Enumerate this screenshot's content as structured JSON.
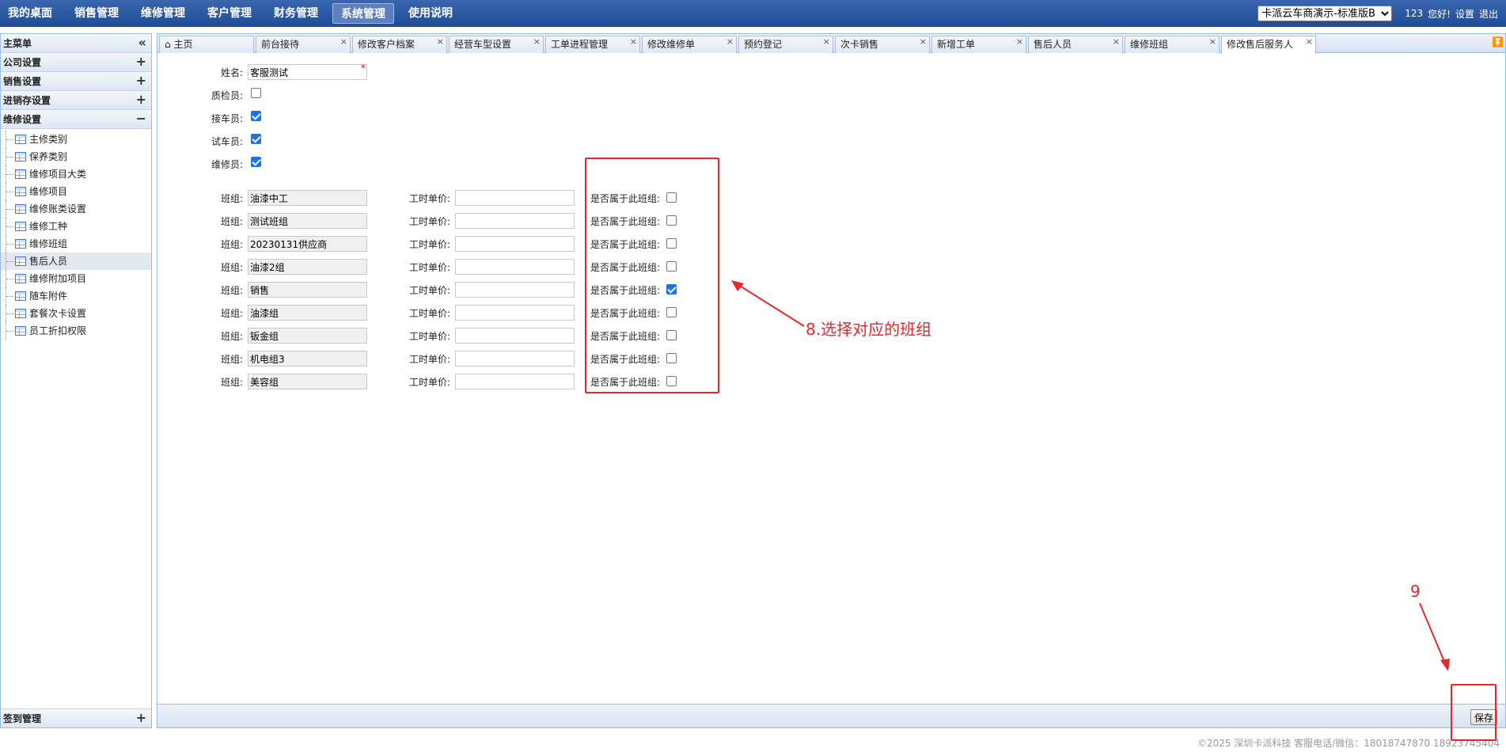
{
  "topnav": {
    "items": [
      "我的桌面",
      "销售管理",
      "维修管理",
      "客户管理",
      "财务管理",
      "系统管理",
      "使用说明"
    ],
    "active_index": 5
  },
  "topright": {
    "store_select": "卡派云车商演示-标准版B",
    "user": "123",
    "greeting": "您好!",
    "settings": "设置",
    "logout": "退出"
  },
  "sidebar": {
    "title": "主菜单",
    "collapse_icon": "double-chevron-left",
    "sections": [
      {
        "label": "公司设置",
        "tool": "+"
      },
      {
        "label": "销售设置",
        "tool": "+"
      },
      {
        "label": "进销存设置",
        "tool": "+"
      },
      {
        "label": "维修设置",
        "tool": "−"
      }
    ],
    "tree_items": [
      "主修类别",
      "保养类别",
      "维修项目大类",
      "维修项目",
      "维修账类设置",
      "维修工种",
      "维修班组",
      "售后人员",
      "维修附加项目",
      "随车附件",
      "套餐次卡设置",
      "员工折扣权限"
    ],
    "selected_item": 7,
    "bottom_section": {
      "label": "签到管理",
      "tool": "+"
    }
  },
  "tabs": [
    {
      "label": "主页",
      "icon": "home-icon",
      "closable": false
    },
    {
      "label": "前台接待",
      "closable": true
    },
    {
      "label": "修改客户档案",
      "closable": true
    },
    {
      "label": "经营车型设置",
      "closable": true
    },
    {
      "label": "工单进程管理",
      "closable": true
    },
    {
      "label": "修改维修单",
      "closable": true
    },
    {
      "label": "预约登记",
      "closable": true
    },
    {
      "label": "次卡销售",
      "closable": true
    },
    {
      "label": "新增工单",
      "closable": true
    },
    {
      "label": "售后人员",
      "closable": true
    },
    {
      "label": "维修班组",
      "closable": true
    },
    {
      "label": "修改售后服务人",
      "closable": true,
      "active": true
    }
  ],
  "form": {
    "name_label": "姓名:",
    "name_value": "客服测试",
    "required_mark": "*",
    "roles": [
      {
        "label": "质检员:",
        "checked": false
      },
      {
        "label": "接车员:",
        "checked": true
      },
      {
        "label": "试车员:",
        "checked": true
      },
      {
        "label": "维修员:",
        "checked": true
      }
    ],
    "group_label": "班组:",
    "price_label": "工时单价:",
    "belong_label": "是否属于此班组:",
    "groups": [
      {
        "name": "油漆中工",
        "price": "",
        "belongs": false
      },
      {
        "name": "测试班组",
        "price": "",
        "belongs": false
      },
      {
        "name": "20230131供应商",
        "price": "",
        "belongs": false
      },
      {
        "name": "油漆2组",
        "price": "",
        "belongs": false
      },
      {
        "name": "销售",
        "price": "",
        "belongs": true
      },
      {
        "name": "油漆组",
        "price": "",
        "belongs": false
      },
      {
        "name": "钣金组",
        "price": "",
        "belongs": false
      },
      {
        "name": "机电组3",
        "price": "",
        "belongs": false
      },
      {
        "name": "美容组",
        "price": "",
        "belongs": false
      }
    ]
  },
  "footer": {
    "save_label": "保存"
  },
  "copyright": "©2025 深圳卡派科技 客服电话/微信：18018747870 18923745404",
  "annotations": {
    "step8": "8.选择对应的班组",
    "step9": "9",
    "color": "#e8262b"
  }
}
